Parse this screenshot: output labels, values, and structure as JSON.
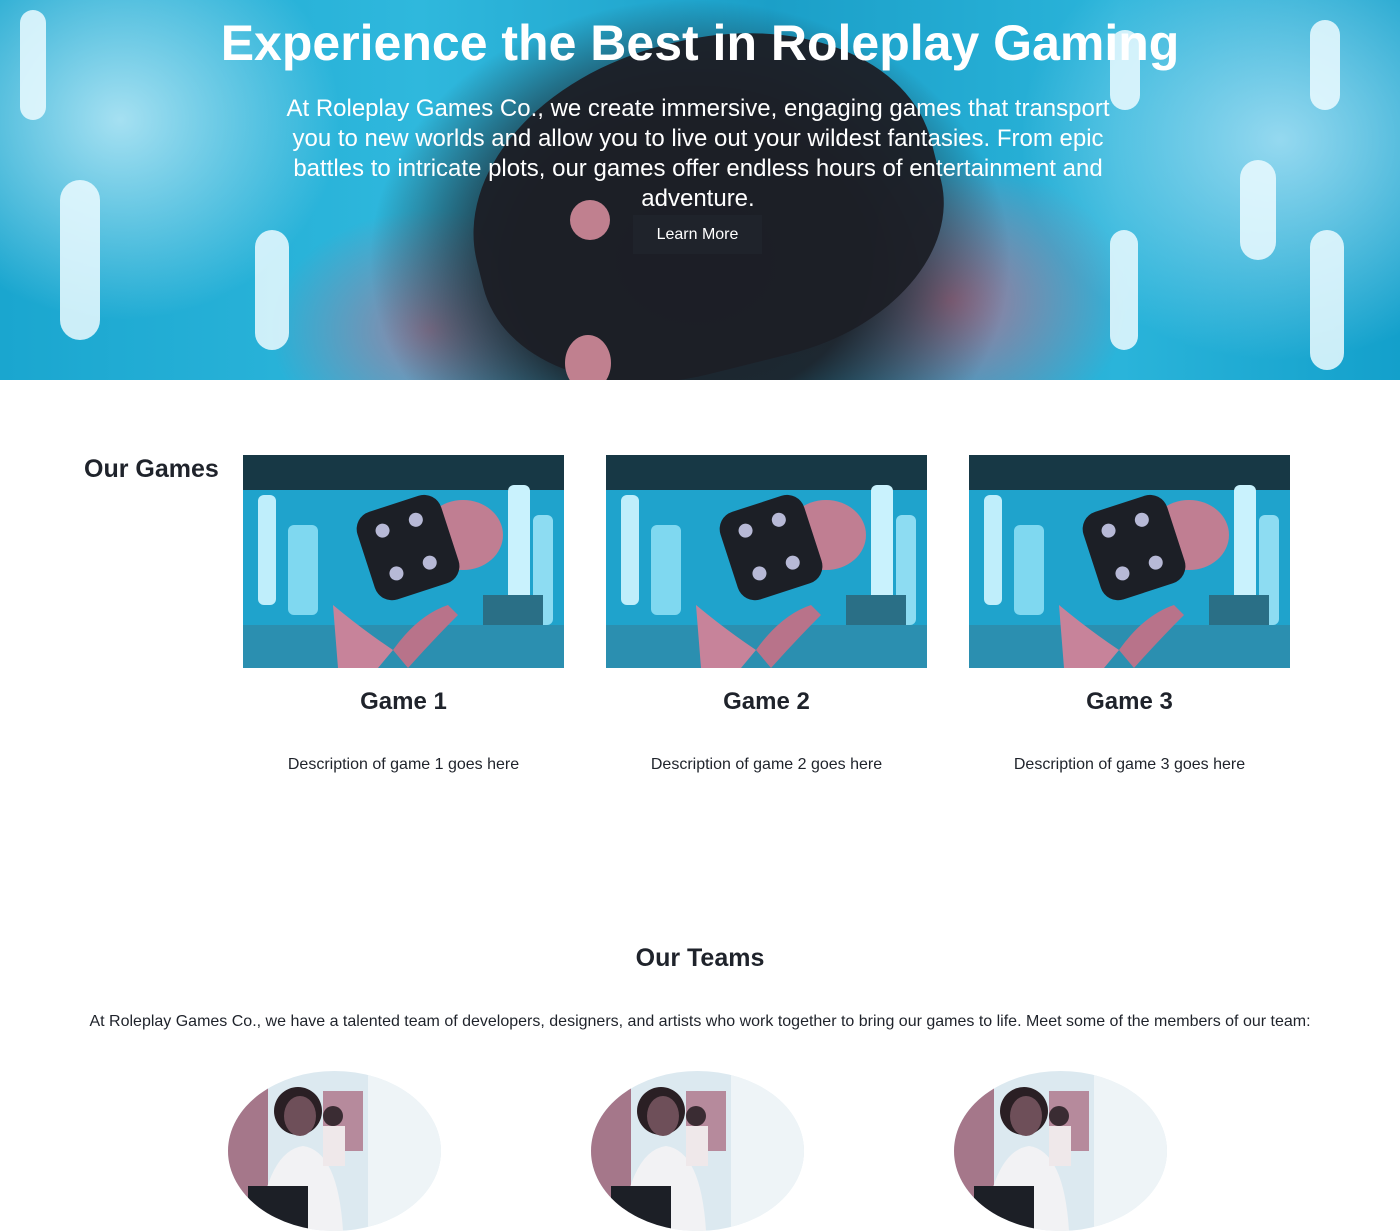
{
  "hero": {
    "title": "Experience the Best in Roleplay Gaming",
    "text": "At Roleplay Games Co., we create immersive, engaging games that transport you to new worlds and allow you to live out your wildest fantasies. From epic battles to intricate plots, our games offer endless hours of entertainment and adventure.",
    "button_label": "Learn More"
  },
  "games": {
    "heading": "Our Games",
    "items": [
      {
        "title": "Game 1",
        "description": "Description of game 1 goes here"
      },
      {
        "title": "Game 2",
        "description": "Description of game 2 goes here"
      },
      {
        "title": "Game 3",
        "description": "Description of game 3 goes here"
      }
    ]
  },
  "teams": {
    "heading": "Our Teams",
    "text": "At Roleplay Games Co., we have a talented team of developers, designers, and artists who work together to bring our games to life. Meet some of the members of our team:"
  },
  "colors": {
    "primary": "#1f232b",
    "accent_cyan": "#1aa6cf",
    "accent_pink": "#c0808f",
    "background": "#ffffff"
  }
}
